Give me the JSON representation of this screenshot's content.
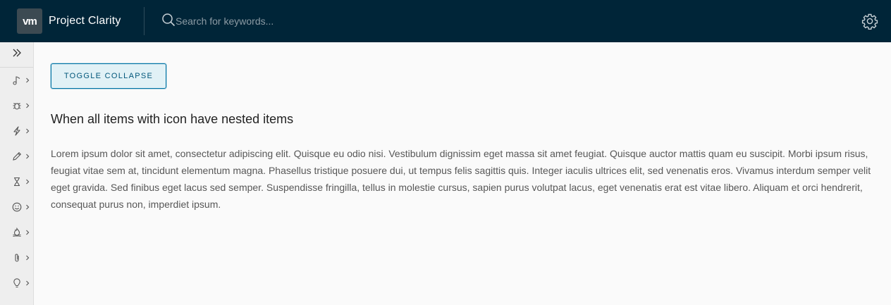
{
  "header": {
    "logo_text": "vm",
    "title": "Project Clarity",
    "search_placeholder": "Search for keywords...",
    "settings_icon": "gear-icon",
    "bg_color": "#002538"
  },
  "sidebar": {
    "collapse_icon": "double-chevron-right-icon",
    "items": [
      {
        "icon": "music-note-icon"
      },
      {
        "icon": "bug-icon"
      },
      {
        "icon": "lightning-icon"
      },
      {
        "icon": "pencil-icon"
      },
      {
        "icon": "hourglass-icon"
      },
      {
        "icon": "smiley-icon"
      },
      {
        "icon": "campfire-icon"
      },
      {
        "icon": "paperclip-icon"
      },
      {
        "icon": "lightbulb-icon"
      }
    ]
  },
  "main": {
    "toggle_label": "TOGGLE COLLAPSE",
    "heading": "When all items with icon have nested items",
    "paragraph": "Lorem ipsum dolor sit amet, consectetur adipiscing elit. Quisque eu odio nisi. Vestibulum dignissim eget massa sit amet feugiat. Quisque auctor mattis quam eu suscipit. Morbi ipsum risus, feugiat vitae sem at, tincidunt elementum magna. Phasellus tristique posuere dui, ut tempus felis sagittis quis. Integer iaculis ultrices elit, sed venenatis eros. Vivamus interdum semper velit eget gravida. Sed finibus eget lacus sed semper. Suspendisse fringilla, tellus in molestie cursus, sapien purus volutpat lacus, eget venenatis erat est vitae libero. Aliquam et orci hendrerit, consequat purus non, imperdiet ipsum.",
    "accent_color": "#0072a3"
  }
}
